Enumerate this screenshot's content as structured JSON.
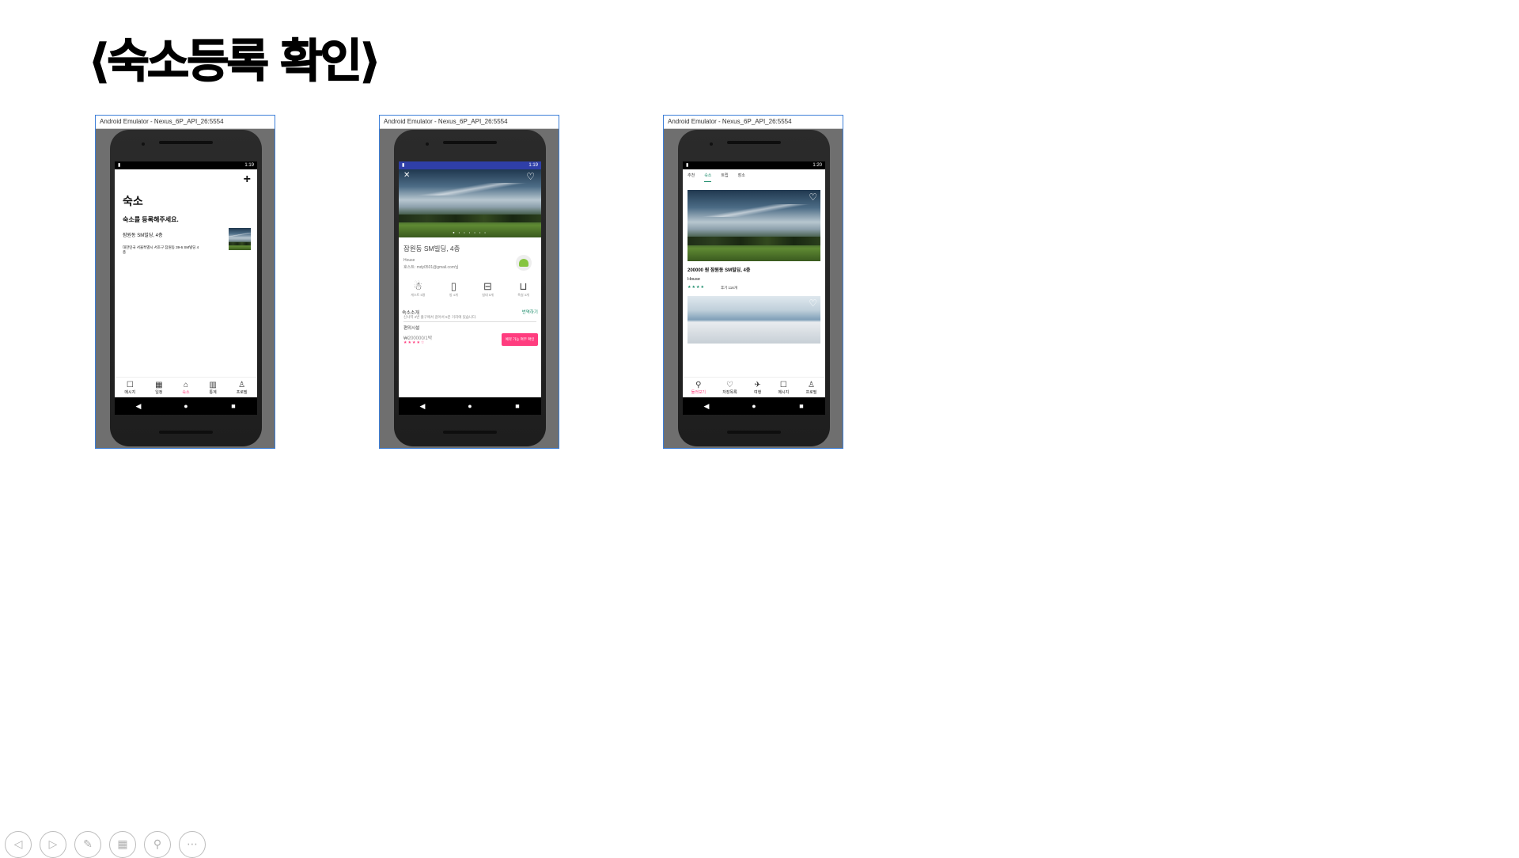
{
  "slide": {
    "title": "⟨숙소등록 확인⟩"
  },
  "emulator_title": "Android Emulator - Nexus_6P_API_26:5554",
  "nav_glyphs": {
    "back": "◀",
    "home": "●",
    "recent": "■"
  },
  "screen1": {
    "status_time": "1:19",
    "add_icon": "+",
    "title": "숙소",
    "subtitle": "숙소를 등록해주세요.",
    "listing_name": "잠원동 SM빌딩, 4층",
    "listing_address": "대한민국 서울특별시 서초구 잠원동 39-6 SM빌딩 4층",
    "tabs": [
      {
        "label": "메시지",
        "icon": "☐"
      },
      {
        "label": "일정",
        "icon": "▦"
      },
      {
        "label": "숙소",
        "icon": "⌂",
        "active": true
      },
      {
        "label": "통계",
        "icon": "▥"
      },
      {
        "label": "프로필",
        "icon": "♙"
      }
    ]
  },
  "screen2": {
    "status_time": "1:19",
    "close_icon": "✕",
    "heart_icon": "♡",
    "dots": "● • • • • • •",
    "title": "잠원동 SM빌딩, 4층",
    "type": "House",
    "host": "호스트: mdy0501@gmail.com님",
    "amenities": [
      {
        "icon": "☃",
        "label": "게스트 5명"
      },
      {
        "icon": "▯",
        "label": "방 4개"
      },
      {
        "icon": "⊟",
        "label": "침대 5개"
      },
      {
        "icon": "⊔",
        "label": "욕실 3개"
      }
    ],
    "intro_title": "숙소소개",
    "translate": "번역하기",
    "intro_desc": "신사역 4번 출구에서 걸어서 5분 거리에 있습니다.",
    "facilities": "편의시설",
    "price": "₩200000/1박",
    "stars": "★★★★☆",
    "check_button": "예약 가능 여부 확인"
  },
  "screen3": {
    "status_time": "1:20",
    "heart_icon": "♡",
    "tabs": [
      "추천",
      "숙소",
      "트립",
      "장소"
    ],
    "active_tab": "숙소",
    "price_line": "200000 원   잠원동 SM빌딩, 4층",
    "type": "House",
    "stars": "★★★★",
    "reviews": "후기 116개",
    "bottom_tabs": [
      {
        "label": "둘러보기",
        "icon": "⚲",
        "active": true
      },
      {
        "label": "저장목록",
        "icon": "♡"
      },
      {
        "label": "여행",
        "icon": "✈"
      },
      {
        "label": "메시지",
        "icon": "☐"
      },
      {
        "label": "프로필",
        "icon": "♙"
      }
    ]
  },
  "toolbar": {
    "buttons": [
      {
        "name": "prev",
        "icon": "◁"
      },
      {
        "name": "next",
        "icon": "▷"
      },
      {
        "name": "pen",
        "icon": "✎"
      },
      {
        "name": "slides",
        "icon": "▦"
      },
      {
        "name": "zoom",
        "icon": "⚲"
      },
      {
        "name": "more",
        "icon": "⋯"
      }
    ]
  }
}
